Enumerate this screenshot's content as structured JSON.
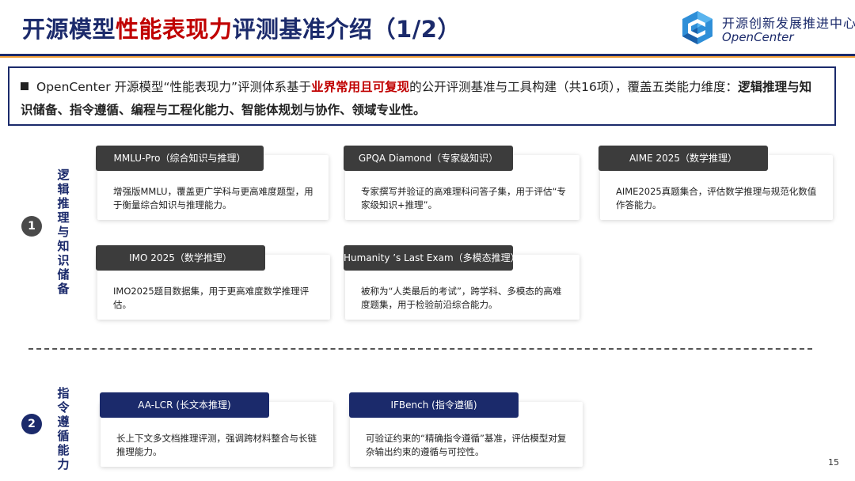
{
  "header": {
    "title_part1": "开源模型",
    "title_highlight": "性能表现力",
    "title_part2": "评测基准介绍（1/2）",
    "logo_line1": "开源创新发展推进中心",
    "logo_line2": "OpenCenter"
  },
  "intro": {
    "part1": "OpenCenter 开源模型“性能表现力”评测体系基于",
    "highlight": "业界常用且可复现",
    "part2": "的公开评测基准与工具构建（共16项），覆盖五类能力维度：",
    "dimensions": "逻辑推理与知识储备、指令遵循、编程与工程化能力、智能体规划与协作、领域专业性。"
  },
  "sections": [
    {
      "number": "1",
      "label": "逻辑推理与知识储备",
      "cards": [
        {
          "tag": "MMLU-Pro（综合知识与推理）",
          "desc": "增强版MMLU，覆盖更广学科与更高难度题型，用于衡量综合知识与推理能力。"
        },
        {
          "tag": "GPQA Diamond（专家级知识）",
          "desc": "专家撰写并验证的高难理科问答子集，用于评估“专家级知识+推理”。"
        },
        {
          "tag": "AIME 2025（数学推理）",
          "desc": "AIME2025真题集合，评估数学推理与规范化数值作答能力。"
        },
        {
          "tag": "IMO 2025（数学推理）",
          "desc": "IMO2025题目数据集，用于更高难度数学推理评估。"
        },
        {
          "tag": "Humanity ’s Last Exam（多模态推理）",
          "desc": "被称为“人类最后的考试”，跨学科、多模态的高难度题集，用于检验前沿综合能力。"
        }
      ]
    },
    {
      "number": "2",
      "label": "指令遵循能力",
      "cards": [
        {
          "tag": "AA-LCR (长文本推理)",
          "desc": "长上下文多文档推理评测，强调跨材料整合与长链推理能力。"
        },
        {
          "tag": "IFBench (指令遵循)",
          "desc": "可验证约束的“精确指令遵循”基准，评估模型对复杂输出约束的遵循与可控性。"
        }
      ]
    }
  ],
  "page_number": "15",
  "colors": {
    "navy": "#1b2a6b",
    "red": "#c00000",
    "orange": "#f4a23a",
    "dark_tag": "#3c3c3c",
    "circle_gray": "#4a4a4a"
  }
}
